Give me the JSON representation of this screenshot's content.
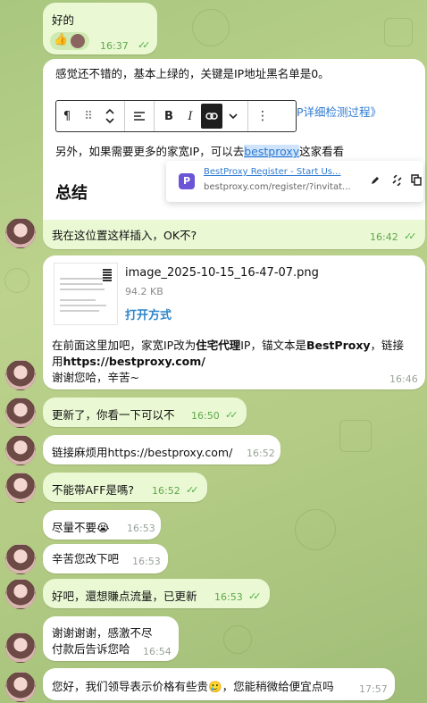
{
  "messages": {
    "m1": {
      "text": "好的",
      "reaction": "👍",
      "time": "16:37"
    },
    "m2": {
      "line1": "感觉还不错的，基本上绿的，关键是IP地址黑名单是0。",
      "link_partial": "P详细检测过程》",
      "line3_pre": "另外，如果需要更多的家宽IP，可以去",
      "line3_link": "bestproxy",
      "line3_post": "这家看看",
      "heading": "总结",
      "caption": "我在这位置这样插入，OK不?",
      "time": "16:42",
      "toolbar": {
        "paragraph_icon": "¶",
        "drag_icon": "⠿",
        "bold": "B",
        "italic": "I"
      },
      "popup": {
        "title": "BestProxy Register - Start Us...",
        "url": "bestproxy.com/register/?invitat...",
        "icon_letter": "P"
      }
    },
    "m3": {
      "file_name": "image_2025-10-15_16-47-07.png",
      "file_size": "94.2 KB",
      "open_with": "打开方式",
      "line1_pre": "在前面这里加吧，家宽IP改为",
      "line1_bold1": "住宅代理",
      "line1_mid": "IP，锚文本是",
      "line1_bold2": "BestProxy",
      "line1_post": "，链接",
      "line2_pre": "用",
      "line2_bold": "https://bestproxy.com/",
      "line3": "谢谢您哈，辛苦~",
      "time": "16:46"
    },
    "m4": {
      "text": "更新了，你看一下可以不",
      "time": "16:50"
    },
    "m5": {
      "text": "链接麻烦用https://bestproxy.com/",
      "time": "16:52"
    },
    "m6": {
      "text": "不能带AFF是嗎?",
      "time": "16:52"
    },
    "m7": {
      "text": "尽量不要",
      "emoji": "😭",
      "time": "16:53"
    },
    "m8": {
      "text": "辛苦您改下吧",
      "time": "16:53"
    },
    "m9": {
      "text": "好吧，還想賺点流量，已更新",
      "time": "16:53"
    },
    "m10": {
      "line1": "谢谢谢谢，感激不尽",
      "line2": "付款后告诉您哈",
      "time": "16:54"
    },
    "m11": {
      "text_pre": "您好，我们领导表示价格有些贵",
      "emoji": "🥲",
      "text_post": "，您能稍微给便宜点吗",
      "time": "17:57"
    }
  },
  "colors": {
    "incoming": "#ffffff",
    "outgoing": "#eaf8d4",
    "accent": "#2f7bd1",
    "check": "#55b04a"
  }
}
